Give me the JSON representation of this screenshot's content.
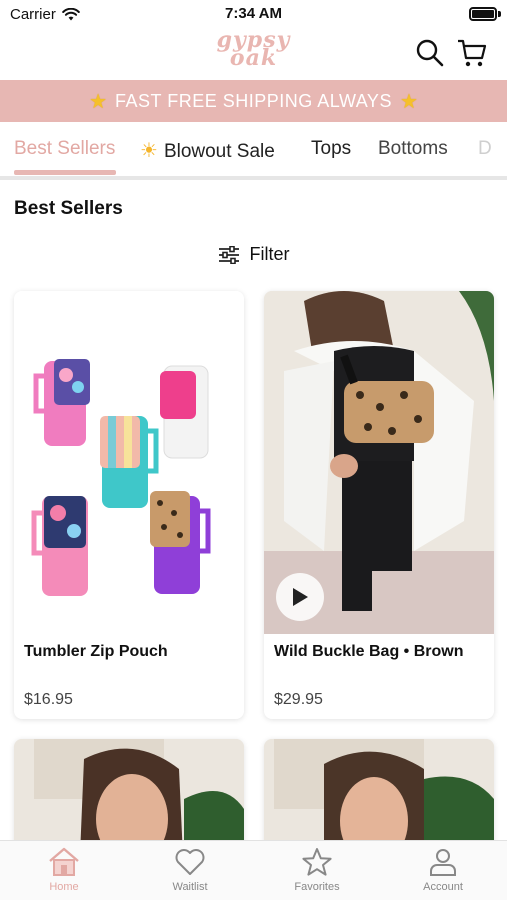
{
  "status_bar": {
    "carrier": "Carrier",
    "time": "7:34 AM"
  },
  "header": {
    "logo_line1": "gypsy",
    "logo_line2": "oak"
  },
  "promo": {
    "text": "FAST FREE SHIPPING ALWAYS"
  },
  "tabs": [
    {
      "label": "Best Sellers",
      "active": true
    },
    {
      "label": "Blowout Sale",
      "icon": "sun-icon"
    },
    {
      "label": "Tops"
    },
    {
      "label": "Bottoms"
    },
    {
      "label": "D"
    }
  ],
  "section": {
    "title": "Best Sellers",
    "filter_label": "Filter"
  },
  "products": [
    {
      "name": "Tumbler Zip Pouch",
      "price": "$16.95"
    },
    {
      "name": "Wild Buckle Bag • Brown",
      "price": "$29.95"
    },
    {
      "name": "",
      "price": ""
    },
    {
      "name": "",
      "price": ""
    }
  ],
  "tabbar": [
    {
      "label": "Home",
      "icon": "home-icon",
      "active": true
    },
    {
      "label": "Waitlist",
      "icon": "heart-icon"
    },
    {
      "label": "Favorites",
      "icon": "star-icon"
    },
    {
      "label": "Account",
      "icon": "person-icon"
    }
  ],
  "colors": {
    "accent_pink": "#e7b7b3",
    "active_pink": "#e2a8a3"
  }
}
